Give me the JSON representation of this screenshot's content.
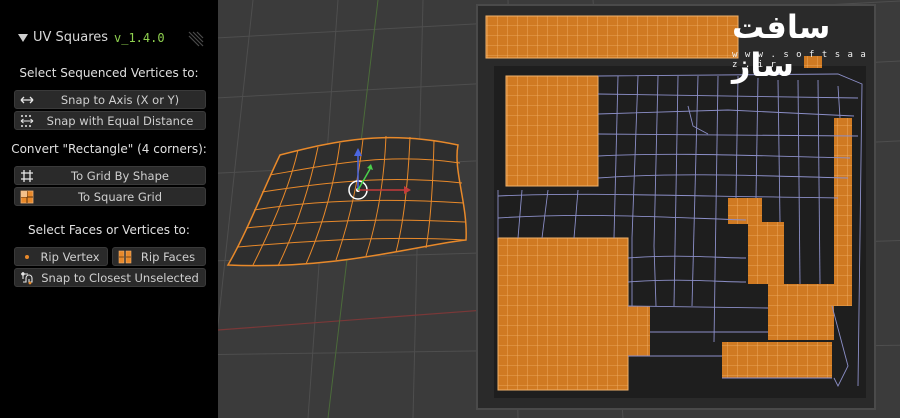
{
  "panel": {
    "title": "UV Squares",
    "version": "v_1.4.0",
    "sections": [
      "Select Sequenced Vertices to:",
      "Convert \"Rectangle\" (4 corners):",
      "Select Faces or Vertices to:"
    ],
    "buttons": {
      "snap_axis": "Snap to Axis (X or Y)",
      "snap_equal": "Snap with Equal Distance",
      "grid_shape": "To Grid By Shape",
      "square_grid": "To Square Grid",
      "rip_vertex": "Rip Vertex",
      "rip_faces": "Rip Faces",
      "snap_closest": "Snap to Closest Unselected"
    },
    "icons": {
      "snap_axis": "horizontal-arrows-icon",
      "snap_equal": "dotted-arrows-icon",
      "grid_shape": "grid-icon",
      "square_grid": "square-grid-icon",
      "rip_vertex": "vertex-dot-icon",
      "rip_faces": "rip-faces-icon",
      "snap_closest": "snap-vertex-icon"
    }
  },
  "watermark": {
    "logo_text": "سافت ساز",
    "url": "w w w . s o f t s a a z . i r"
  },
  "colors": {
    "accent_orange": "#e8892a",
    "version_green": "#8fd14f",
    "panel_bg": "#000000",
    "viewport_bg": "#3c3c3c"
  }
}
